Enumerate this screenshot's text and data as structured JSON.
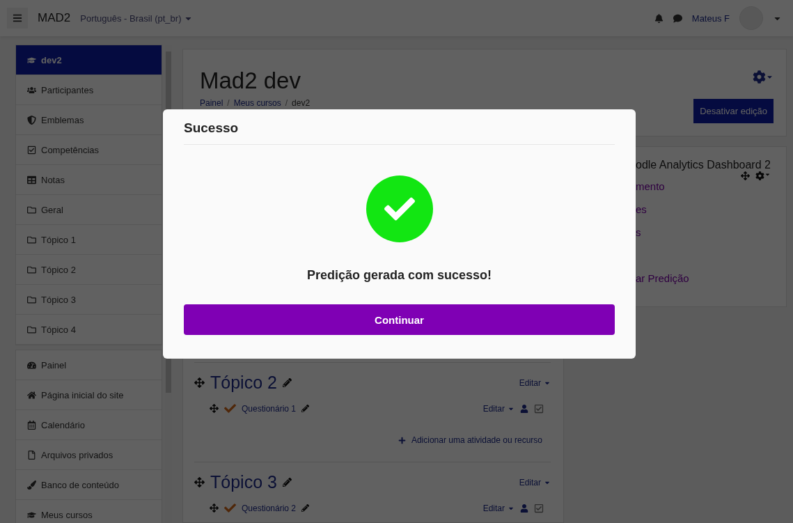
{
  "navbar": {
    "brand": "MAD2",
    "language": "Português - Brasil (pt_br)",
    "user": "Mateus F"
  },
  "sidebar": {
    "groups": [
      {
        "items": [
          {
            "label": "dev2",
            "kind": "cap",
            "selected": true
          },
          {
            "label": "Participantes",
            "kind": "users",
            "selected": false
          },
          {
            "label": "Emblemas",
            "kind": "shield",
            "selected": false
          },
          {
            "label": "Competências",
            "kind": "check",
            "selected": false
          },
          {
            "label": "Notas",
            "kind": "table",
            "selected": false
          },
          {
            "label": "Geral",
            "kind": "folder",
            "selected": false
          },
          {
            "label": "Tópico 1",
            "kind": "folder",
            "selected": false
          },
          {
            "label": "Tópico 2",
            "kind": "folder",
            "selected": false
          },
          {
            "label": "Tópico 3",
            "kind": "folder",
            "selected": false
          },
          {
            "label": "Tópico 4",
            "kind": "folder",
            "selected": false
          }
        ]
      },
      {
        "items": [
          {
            "label": "Painel",
            "kind": "gauge",
            "selected": false
          },
          {
            "label": "Página inicial do site",
            "kind": "home",
            "selected": false
          },
          {
            "label": "Calendário",
            "kind": "calendar",
            "selected": false
          },
          {
            "label": "Arquivos privados",
            "kind": "file",
            "selected": false
          },
          {
            "label": "Banco de conteúdo",
            "kind": "brush",
            "selected": false
          },
          {
            "label": "Meus cursos",
            "kind": "cap",
            "selected": false
          }
        ]
      }
    ]
  },
  "course": {
    "title": "Mad2 dev",
    "breadcrumb": [
      "Painel",
      "Meus cursos",
      "dev2"
    ],
    "separator": "/",
    "edit_button": "Desativar edição"
  },
  "topics": [
    {
      "title": "Tópico 2",
      "edit": "Editar",
      "activities": [
        {
          "name": "Questionário 1",
          "edit": "Editar"
        }
      ],
      "add_activity": "Adicionar uma atividade ou recurso"
    },
    {
      "title": "Tópico 3",
      "edit": "Editar",
      "activities": [
        {
          "name": "Questionário 2",
          "edit": "Editar"
        }
      ]
    }
  ],
  "block": {
    "title": "odle Analytics Dashboard 2",
    "links": [
      "mento",
      "es",
      "s",
      "ar Predição"
    ]
  },
  "modal": {
    "title": "Sucesso",
    "message": "Predição gerada com sucesso!",
    "button": "Continuar"
  }
}
